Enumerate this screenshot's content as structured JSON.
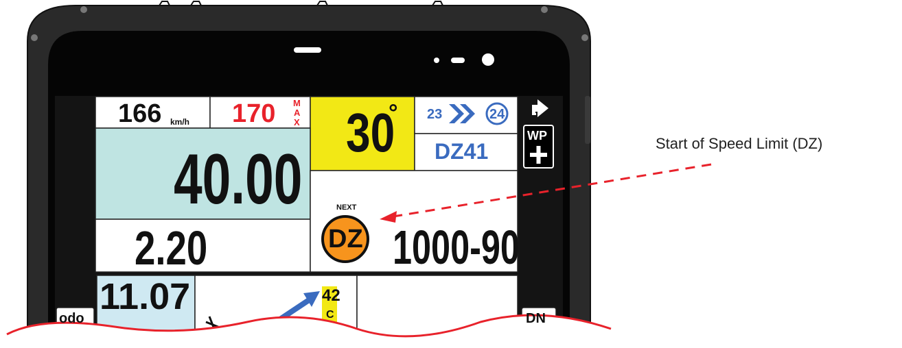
{
  "speed": {
    "value": "166",
    "unit": "km/h"
  },
  "max_speed": {
    "value": "170",
    "label_letters": [
      "M",
      "A",
      "X"
    ]
  },
  "heading": {
    "value": "30",
    "degree": "°"
  },
  "waypoint": {
    "current": "23",
    "next": "24",
    "zone": "DZ41"
  },
  "distance": {
    "main": "40.00",
    "partial": "2.20"
  },
  "next_instruction": {
    "caption": "NEXT",
    "badge": "DZ",
    "value": "1000-90"
  },
  "odo": {
    "button": "odo",
    "value": "11.07"
  },
  "roadbook": {
    "box_number": "42",
    "box_letter": "C"
  },
  "side_buttons": {
    "wp_top": "WP",
    "wp_plus": "+",
    "dn": "DN"
  },
  "annotation": {
    "text": "Start of Speed Limit (DZ)"
  },
  "colors": {
    "accent_red": "#e8222b",
    "blue": "#3a6bbf",
    "teal_panel": "#bfe4e2",
    "yellow": "#f2e815",
    "orange": "#f7941d"
  }
}
